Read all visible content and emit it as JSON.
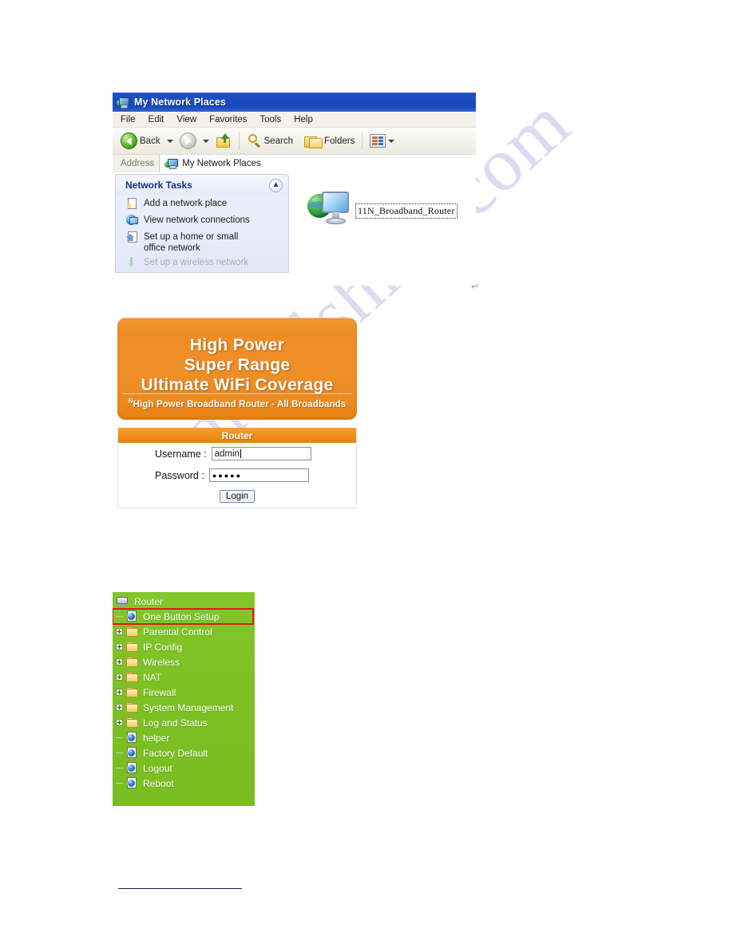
{
  "explorer": {
    "window_title": "My Network Places",
    "title_icon": "network-places-icon",
    "menus": [
      "File",
      "Edit",
      "View",
      "Favorites",
      "Tools",
      "Help"
    ],
    "toolbar": {
      "back_label": "Back",
      "back_icon": "back-arrow-icon",
      "back_dropdown_icon": "chevron-down-icon",
      "forward_icon": "forward-arrow-icon",
      "forward_dropdown_icon": "chevron-down-icon",
      "up_icon": "up-one-level-icon",
      "search_label": "Search",
      "search_icon": "magnifier-icon",
      "folders_label": "Folders",
      "folders_icon": "folders-icon",
      "views_icon": "views-icon",
      "views_dropdown_icon": "chevron-down-icon"
    },
    "address": {
      "label": "Address",
      "icon": "network-places-icon",
      "value": "My Network Places"
    },
    "tasks_panel": {
      "title": "Network Tasks",
      "collapse_icon": "chevron-up-icon",
      "items": [
        {
          "label": "Add a network place",
          "icon": "add-network-place-icon"
        },
        {
          "label": "View network connections",
          "icon": "view-connections-icon"
        },
        {
          "label": "Set up a home or small office network",
          "icon": "home-network-icon"
        },
        {
          "label": "Set up a wireless network",
          "icon": "wireless-network-icon"
        }
      ]
    },
    "network_item": {
      "label": "11N_Broadband_Router",
      "icon": "network-computer-icon"
    }
  },
  "paragraph_mark": "↵",
  "banner": {
    "line1": "High Power",
    "line2": "Super Range",
    "line3": "Ultimate WiFi Coverage",
    "sup": "N",
    "subtitle": "High Power Broadband Router - All Broadbands",
    "color": "#ef8f28"
  },
  "login": {
    "header": "Router",
    "username_label": "Username :",
    "username_value": "admin",
    "password_label": "Password :",
    "password_value": "●●●●●",
    "button_label": "Login",
    "header_color": "#ef8d1b"
  },
  "tree": {
    "background_color": "#7cc024",
    "highlight_color": "#e01b12",
    "root": {
      "label": "Router",
      "icon": "server-icon"
    },
    "items": [
      {
        "label": "One Button Setup",
        "icon": "page-globe-icon",
        "type": "leaf",
        "expandable": false,
        "highlighted": true
      },
      {
        "label": "Parental Control",
        "icon": "folder-icon",
        "type": "folder",
        "expandable": true,
        "highlighted": false
      },
      {
        "label": "IP Config",
        "icon": "folder-icon",
        "type": "folder",
        "expandable": true,
        "highlighted": false
      },
      {
        "label": "Wireless",
        "icon": "folder-icon",
        "type": "folder",
        "expandable": true,
        "highlighted": false
      },
      {
        "label": "NAT",
        "icon": "folder-icon",
        "type": "folder",
        "expandable": true,
        "highlighted": false
      },
      {
        "label": "Firewall",
        "icon": "folder-icon",
        "type": "folder",
        "expandable": true,
        "highlighted": false
      },
      {
        "label": "System Management",
        "icon": "folder-icon",
        "type": "folder",
        "expandable": true,
        "highlighted": false
      },
      {
        "label": "Log and Status",
        "icon": "folder-icon",
        "type": "folder",
        "expandable": true,
        "highlighted": false
      },
      {
        "label": "helper",
        "icon": "page-globe-icon",
        "type": "leaf",
        "expandable": false,
        "highlighted": false
      },
      {
        "label": "Factory Default",
        "icon": "page-globe-icon",
        "type": "leaf",
        "expandable": false,
        "highlighted": false
      },
      {
        "label": "Logout",
        "icon": "page-globe-icon",
        "type": "leaf",
        "expandable": false,
        "highlighted": false
      },
      {
        "label": "Reboot",
        "icon": "page-globe-icon",
        "type": "leaf",
        "expandable": false,
        "highlighted": false
      }
    ]
  },
  "watermark": {
    "text": "manualshive.com"
  }
}
